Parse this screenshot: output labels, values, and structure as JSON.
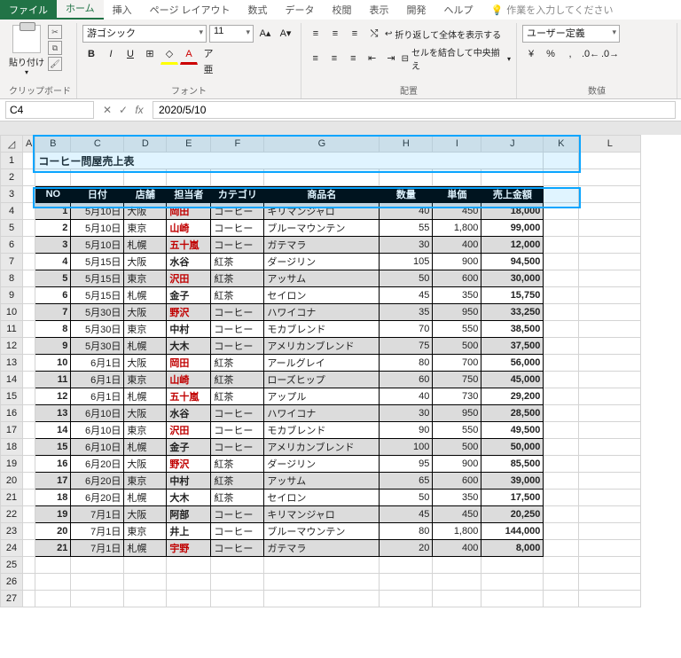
{
  "tabs": {
    "file": "ファイル",
    "home": "ホーム",
    "insert": "挿入",
    "layout": "ページ レイアウト",
    "formulas": "数式",
    "data": "データ",
    "review": "校閲",
    "view": "表示",
    "dev": "開発",
    "help": "ヘルプ",
    "tell": "作業を入力してください"
  },
  "ribbon": {
    "clipboard": {
      "paste": "貼り付け",
      "label": "クリップボード"
    },
    "font": {
      "name": "游ゴシック",
      "size": "11",
      "label": "フォント"
    },
    "align": {
      "wrap": "折り返して全体を表示する",
      "merge": "セルを結合して中央揃え",
      "label": "配置"
    },
    "number": {
      "format": "ユーザー定義",
      "label": "数値"
    }
  },
  "namebox": "C4",
  "formulabar": "2020/5/10",
  "colheaders": [
    "A",
    "B",
    "C",
    "D",
    "E",
    "F",
    "G",
    "H",
    "I",
    "J",
    "K",
    "L"
  ],
  "title": "コーヒー問屋売上表",
  "dataheaders": {
    "no": "NO",
    "date": "日付",
    "store": "店舗",
    "person": "担当者",
    "cat": "カテゴリ",
    "product": "商品名",
    "qty": "数量",
    "price": "単価",
    "sales": "売上金額"
  },
  "rows": [
    {
      "r": 4,
      "no": "1",
      "date": "5月10日",
      "store": "大阪",
      "person": "岡田",
      "red": true,
      "cat": "コーヒー",
      "product": "キリマンジャロ",
      "qty": "40",
      "price": "450",
      "sales": "18,000",
      "alt": true
    },
    {
      "r": 5,
      "no": "2",
      "date": "5月10日",
      "store": "東京",
      "person": "山崎",
      "red": true,
      "cat": "コーヒー",
      "product": "ブルーマウンテン",
      "qty": "55",
      "price": "1,800",
      "sales": "99,000"
    },
    {
      "r": 6,
      "no": "3",
      "date": "5月10日",
      "store": "札幌",
      "person": "五十嵐",
      "red": true,
      "cat": "コーヒー",
      "product": "ガテマラ",
      "qty": "30",
      "price": "400",
      "sales": "12,000",
      "alt": true
    },
    {
      "r": 7,
      "no": "4",
      "date": "5月15日",
      "store": "大阪",
      "person": "水谷",
      "cat": "紅茶",
      "product": "ダージリン",
      "qty": "105",
      "price": "900",
      "sales": "94,500"
    },
    {
      "r": 8,
      "no": "5",
      "date": "5月15日",
      "store": "東京",
      "person": "沢田",
      "red": true,
      "cat": "紅茶",
      "product": "アッサム",
      "qty": "50",
      "price": "600",
      "sales": "30,000",
      "alt": true
    },
    {
      "r": 9,
      "no": "6",
      "date": "5月15日",
      "store": "札幌",
      "person": "金子",
      "cat": "紅茶",
      "product": "セイロン",
      "qty": "45",
      "price": "350",
      "sales": "15,750"
    },
    {
      "r": 10,
      "no": "7",
      "date": "5月30日",
      "store": "大阪",
      "person": "野沢",
      "red": true,
      "cat": "コーヒー",
      "product": "ハワイコナ",
      "qty": "35",
      "price": "950",
      "sales": "33,250",
      "alt": true
    },
    {
      "r": 11,
      "no": "8",
      "date": "5月30日",
      "store": "東京",
      "person": "中村",
      "cat": "コーヒー",
      "product": "モカブレンド",
      "qty": "70",
      "price": "550",
      "sales": "38,500"
    },
    {
      "r": 12,
      "no": "9",
      "date": "5月30日",
      "store": "札幌",
      "person": "大木",
      "cat": "コーヒー",
      "product": "アメリカンブレンド",
      "qty": "75",
      "price": "500",
      "sales": "37,500",
      "alt": true
    },
    {
      "r": 13,
      "no": "10",
      "date": "6月1日",
      "store": "大阪",
      "person": "岡田",
      "red": true,
      "cat": "紅茶",
      "product": "アールグレイ",
      "qty": "80",
      "price": "700",
      "sales": "56,000"
    },
    {
      "r": 14,
      "no": "11",
      "date": "6月1日",
      "store": "東京",
      "person": "山崎",
      "red": true,
      "cat": "紅茶",
      "product": "ローズヒップ",
      "qty": "60",
      "price": "750",
      "sales": "45,000",
      "alt": true
    },
    {
      "r": 15,
      "no": "12",
      "date": "6月1日",
      "store": "札幌",
      "person": "五十嵐",
      "red": true,
      "cat": "紅茶",
      "product": "アップル",
      "qty": "40",
      "price": "730",
      "sales": "29,200"
    },
    {
      "r": 16,
      "no": "13",
      "date": "6月10日",
      "store": "大阪",
      "person": "水谷",
      "cat": "コーヒー",
      "product": "ハワイコナ",
      "qty": "30",
      "price": "950",
      "sales": "28,500",
      "alt": true
    },
    {
      "r": 17,
      "no": "14",
      "date": "6月10日",
      "store": "東京",
      "person": "沢田",
      "red": true,
      "cat": "コーヒー",
      "product": "モカブレンド",
      "qty": "90",
      "price": "550",
      "sales": "49,500"
    },
    {
      "r": 18,
      "no": "15",
      "date": "6月10日",
      "store": "札幌",
      "person": "金子",
      "cat": "コーヒー",
      "product": "アメリカンブレンド",
      "qty": "100",
      "price": "500",
      "sales": "50,000",
      "alt": true
    },
    {
      "r": 19,
      "no": "16",
      "date": "6月20日",
      "store": "大阪",
      "person": "野沢",
      "red": true,
      "cat": "紅茶",
      "product": "ダージリン",
      "qty": "95",
      "price": "900",
      "sales": "85,500"
    },
    {
      "r": 20,
      "no": "17",
      "date": "6月20日",
      "store": "東京",
      "person": "中村",
      "cat": "紅茶",
      "product": "アッサム",
      "qty": "65",
      "price": "600",
      "sales": "39,000",
      "alt": true
    },
    {
      "r": 21,
      "no": "18",
      "date": "6月20日",
      "store": "札幌",
      "person": "大木",
      "cat": "紅茶",
      "product": "セイロン",
      "qty": "50",
      "price": "350",
      "sales": "17,500"
    },
    {
      "r": 22,
      "no": "19",
      "date": "7月1日",
      "store": "大阪",
      "person": "阿部",
      "cat": "コーヒー",
      "product": "キリマンジャロ",
      "qty": "45",
      "price": "450",
      "sales": "20,250",
      "alt": true
    },
    {
      "r": 23,
      "no": "20",
      "date": "7月1日",
      "store": "東京",
      "person": "井上",
      "cat": "コーヒー",
      "product": "ブルーマウンテン",
      "qty": "80",
      "price": "1,800",
      "sales": "144,000"
    },
    {
      "r": 24,
      "no": "21",
      "date": "7月1日",
      "store": "札幌",
      "person": "宇野",
      "red": true,
      "cat": "コーヒー",
      "product": "ガテマラ",
      "qty": "20",
      "price": "400",
      "sales": "8,000",
      "alt": true
    }
  ]
}
